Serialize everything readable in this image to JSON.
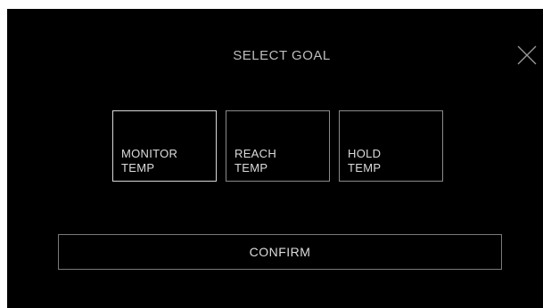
{
  "screen": {
    "title": "SELECT GOAL",
    "close_icon": "close-icon"
  },
  "goal_options": [
    {
      "line1": "MONITOR",
      "line2": "TEMP",
      "selected": true
    },
    {
      "line1": "REACH",
      "line2": "TEMP",
      "selected": false
    },
    {
      "line1": "HOLD",
      "line2": "TEMP",
      "selected": false
    }
  ],
  "confirm_label": "CONFIRM",
  "colors": {
    "background": "#000000",
    "text": "#dcdcdc",
    "border": "#8a8a8a"
  }
}
